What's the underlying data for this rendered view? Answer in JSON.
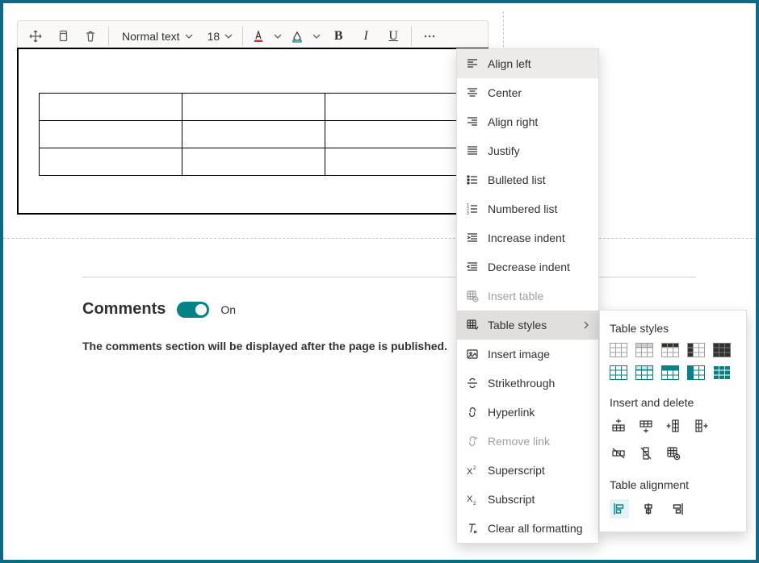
{
  "toolbar": {
    "text_style": "Normal text",
    "font_size": "18",
    "bold_glyph": "B",
    "italic_glyph": "I",
    "underline_glyph": "U",
    "font_color_accent": "#d13438",
    "highlight_accent": "#038387"
  },
  "menu": {
    "items": [
      {
        "id": "align-left",
        "label": "Align left",
        "state": "hover"
      },
      {
        "id": "center",
        "label": "Center",
        "state": ""
      },
      {
        "id": "align-right",
        "label": "Align right",
        "state": ""
      },
      {
        "id": "justify",
        "label": "Justify",
        "state": ""
      },
      {
        "id": "bulleted-list",
        "label": "Bulleted list",
        "state": ""
      },
      {
        "id": "numbered-list",
        "label": "Numbered list",
        "state": ""
      },
      {
        "id": "increase-indent",
        "label": "Increase indent",
        "state": ""
      },
      {
        "id": "decrease-indent",
        "label": "Decrease indent",
        "state": ""
      },
      {
        "id": "insert-table",
        "label": "Insert table",
        "state": "disabled"
      },
      {
        "id": "table-styles",
        "label": "Table styles",
        "state": "selected",
        "has_sub": true
      },
      {
        "id": "insert-image",
        "label": "Insert image",
        "state": ""
      },
      {
        "id": "strikethrough",
        "label": "Strikethrough",
        "state": ""
      },
      {
        "id": "hyperlink",
        "label": "Hyperlink",
        "state": ""
      },
      {
        "id": "remove-link",
        "label": "Remove link",
        "state": "disabled"
      },
      {
        "id": "superscript",
        "label": "Superscript",
        "state": ""
      },
      {
        "id": "subscript",
        "label": "Subscript",
        "state": ""
      },
      {
        "id": "clear-formatting",
        "label": "Clear all formatting",
        "state": ""
      }
    ]
  },
  "submenu": {
    "section_styles": "Table styles",
    "section_insert_delete": "Insert and delete",
    "section_alignment": "Table alignment",
    "styles_row1_fill": "#323130",
    "styles_row2_fill": "#038387"
  },
  "comments": {
    "title": "Comments",
    "toggle_on": true,
    "toggle_label": "On",
    "message": "The comments section will be displayed after the page is published."
  }
}
